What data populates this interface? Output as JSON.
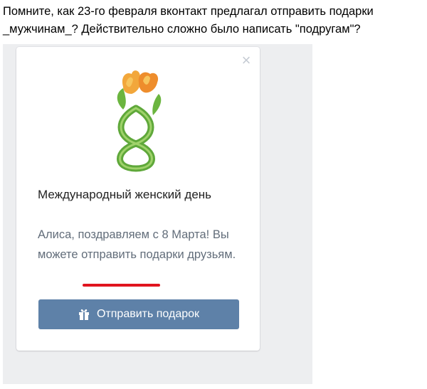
{
  "post": {
    "text": "Помните, как 23-го февраля вконтакт предлагал отправить подарки _мужчинам_? Действительно сложно было написать \"подругам\"?"
  },
  "card": {
    "close_icon": "×",
    "title": "Международный женский день",
    "description": "Алиса, поздравляем с 8 Марта! Вы можете отправить подарки друзьям.",
    "button_label": "Отправить подарок",
    "button_icon": "gift-icon",
    "illustration": "tulip-eight-illustration"
  },
  "colors": {
    "background": "#edeef0",
    "button": "#5e81a8",
    "underline": "#e0141f",
    "description_text": "#626d7a"
  }
}
